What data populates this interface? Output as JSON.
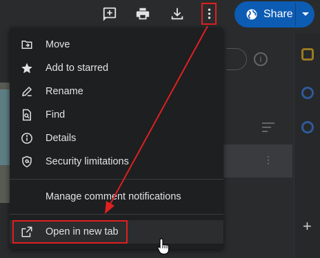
{
  "toolbar": {
    "icons": [
      "add-comment-icon",
      "print-icon",
      "download-icon",
      "more-vert-icon"
    ],
    "share_label": "Share"
  },
  "menu": {
    "items": [
      {
        "label": "Move",
        "icon": "move-to-folder-icon"
      },
      {
        "label": "Add to starred",
        "icon": "star-icon"
      },
      {
        "label": "Rename",
        "icon": "pencil-icon"
      },
      {
        "label": "Find",
        "icon": "find-file-icon"
      },
      {
        "label": "Details",
        "icon": "info-icon"
      },
      {
        "label": "Security limitations",
        "icon": "shield-icon"
      },
      {
        "label": "Manage comment notifications"
      },
      {
        "label": "Open in new tab",
        "icon": "open-in-new-icon"
      }
    ]
  },
  "colors": {
    "menu_bg": "#1e1f20",
    "share_bg": "#0c5cb4",
    "highlight": "#e02020"
  }
}
